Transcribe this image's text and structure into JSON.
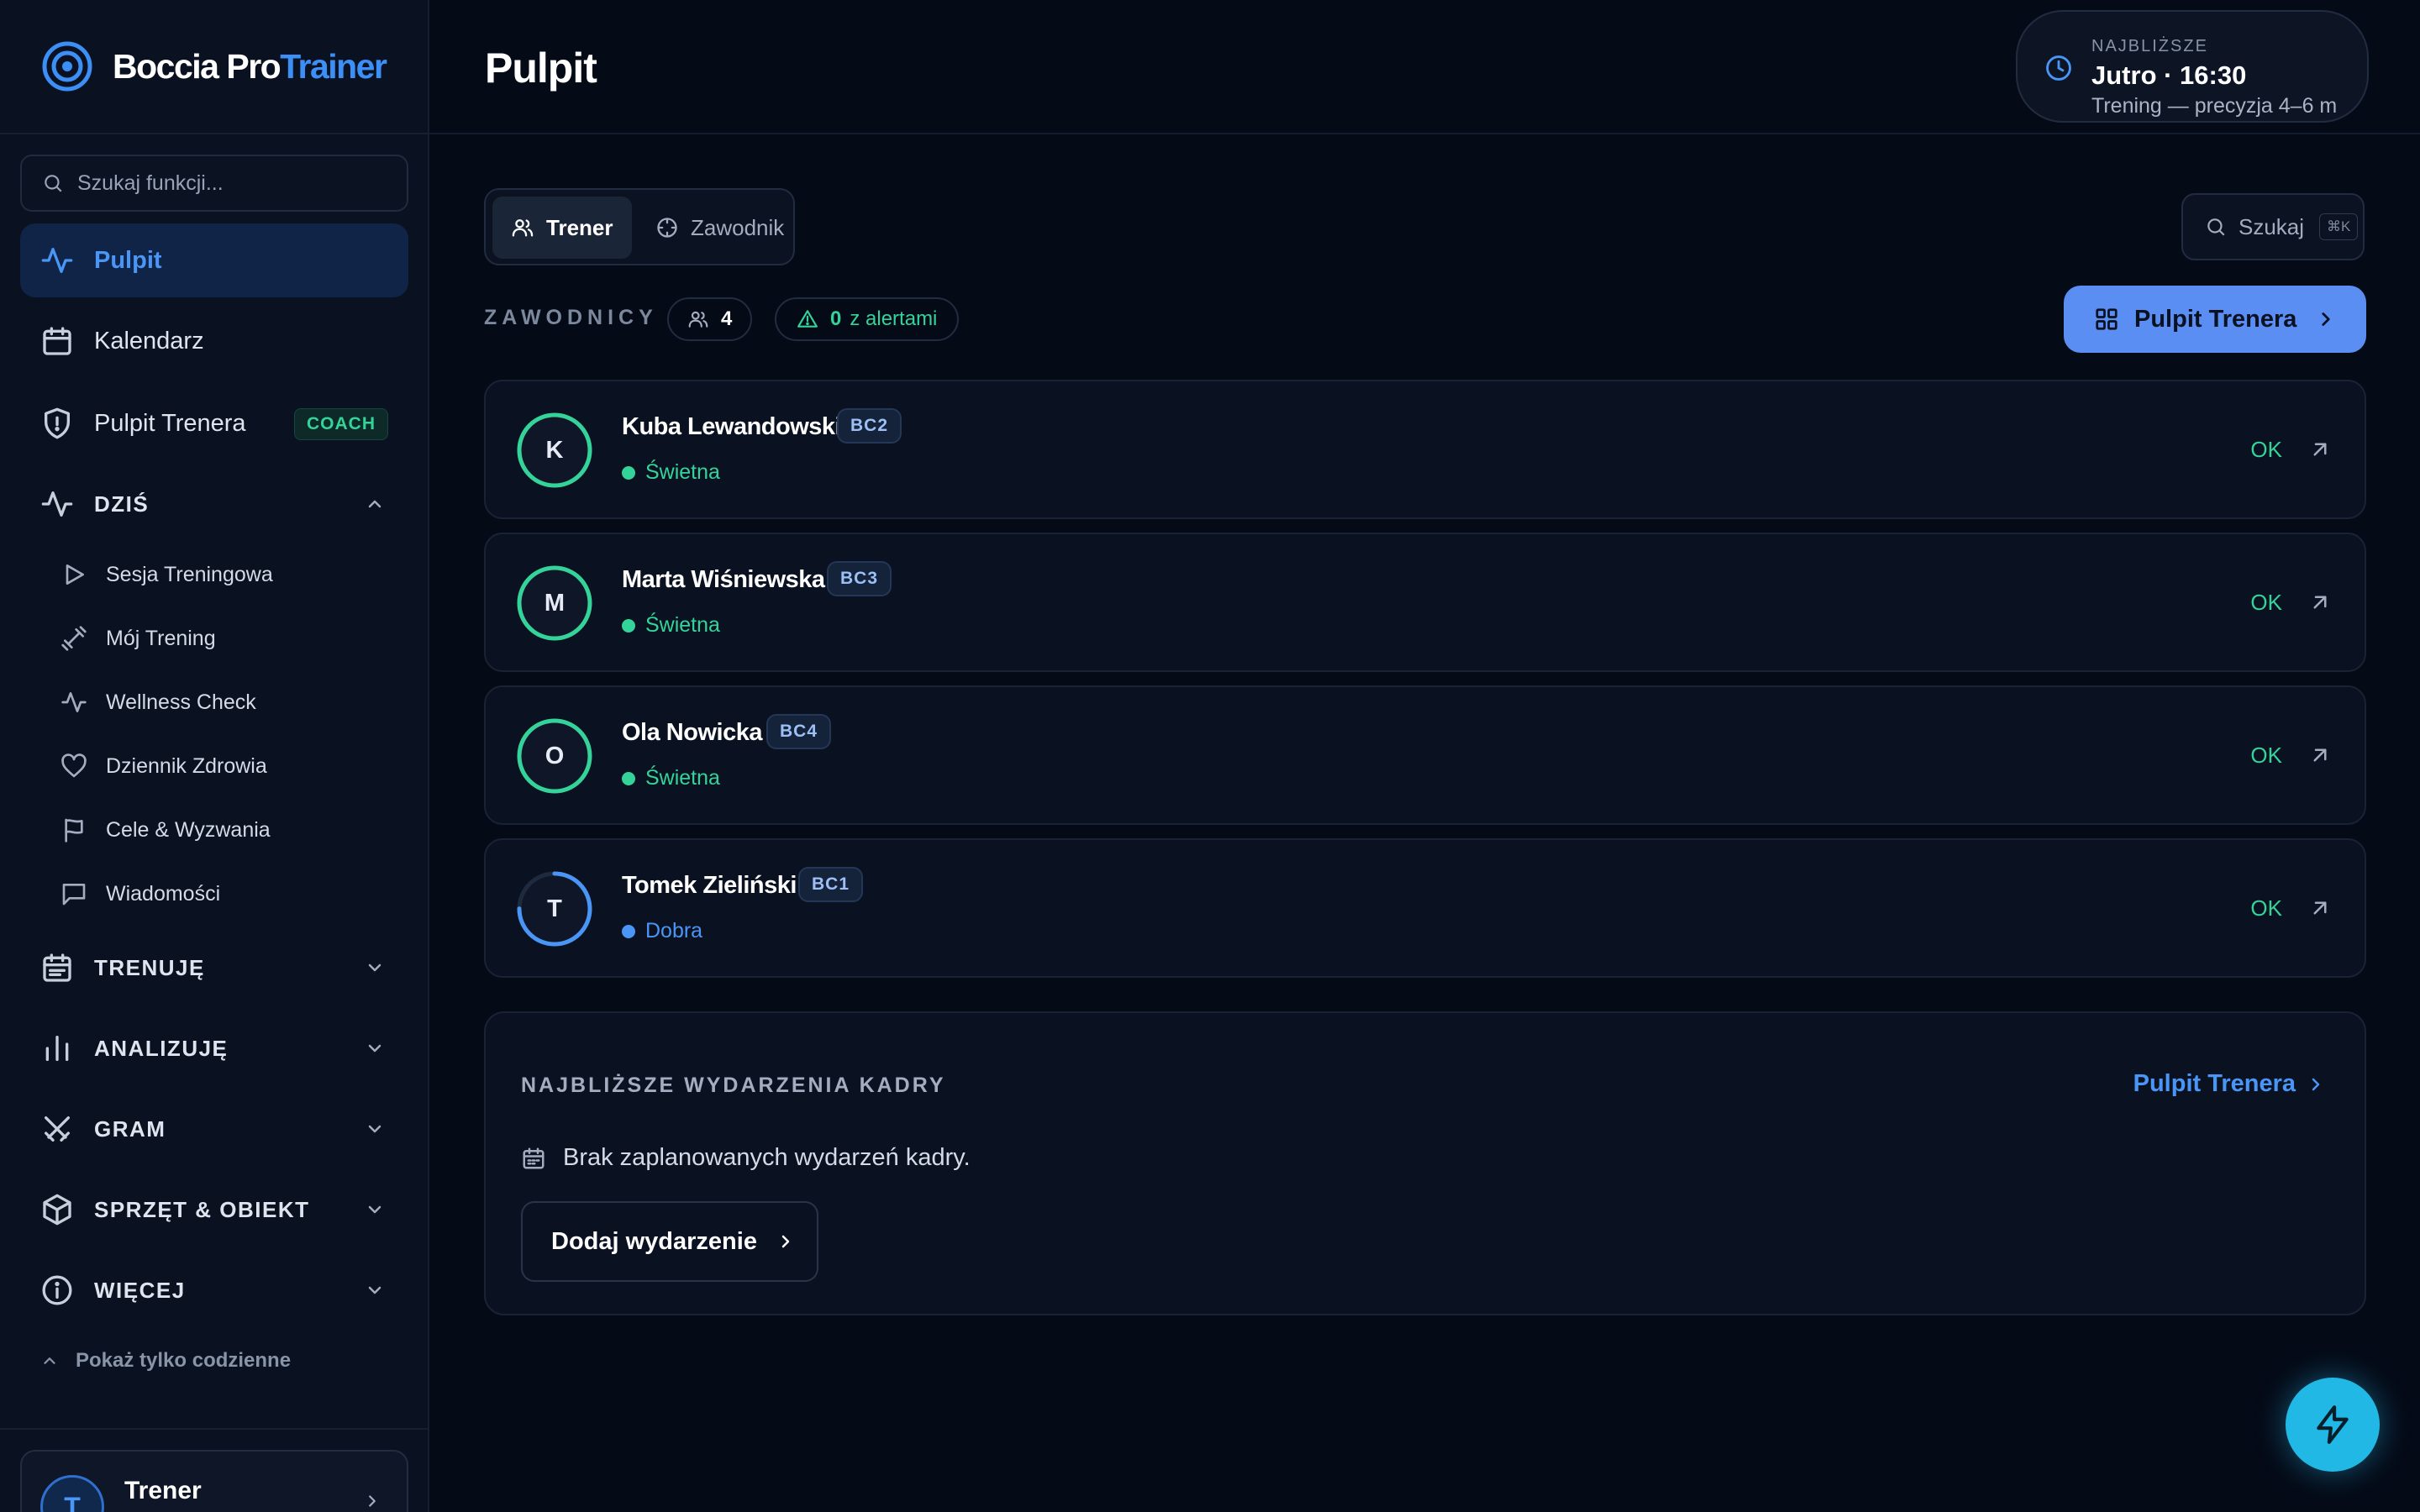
{
  "app": {
    "brand_main": "Boccia Pro",
    "brand_accent": "Trainer",
    "accent_color": "#3b8ff7"
  },
  "sidebar": {
    "search_placeholder": "Szukaj funkcji...",
    "nav": [
      {
        "label": "Pulpit",
        "icon": "activity-icon",
        "active": true
      },
      {
        "label": "Kalendarz",
        "icon": "calendar-icon"
      },
      {
        "label": "Pulpit Trenera",
        "icon": "shield-icon",
        "badge": "COACH"
      }
    ],
    "today": {
      "label": "DZIŚ",
      "items": [
        {
          "label": "Sesja Treningowa",
          "icon": "play-icon"
        },
        {
          "label": "Mój Trening",
          "icon": "dumbbell-icon"
        },
        {
          "label": "Wellness Check",
          "icon": "pulse-icon"
        },
        {
          "label": "Dziennik Zdrowia",
          "icon": "heart-icon"
        },
        {
          "label": "Cele & Wyzwania",
          "icon": "flag-icon"
        },
        {
          "label": "Wiadomości",
          "icon": "message-icon"
        }
      ]
    },
    "sections": [
      {
        "label": "TRENUJĘ",
        "icon": "calendar-list-icon"
      },
      {
        "label": "ANALIZUJĘ",
        "icon": "bar-chart-icon"
      },
      {
        "label": "GRAM",
        "icon": "swords-icon"
      },
      {
        "label": "SPRZĘT & OBIEKT",
        "icon": "box-icon"
      },
      {
        "label": "WIĘCEJ",
        "icon": "info-icon"
      }
    ],
    "show_daily": "Pokaż tylko codzienne",
    "user": {
      "initial": "T",
      "name": "Trener"
    }
  },
  "header": {
    "title": "Pulpit",
    "next": {
      "label": "NAJBLIŻSZE",
      "time": "Jutro · 16:30",
      "desc": "Trening — precyzja 4–6 m"
    }
  },
  "main": {
    "roles": [
      {
        "label": "Trener",
        "active": true
      },
      {
        "label": "Zawodnik"
      }
    ],
    "search_label": "Szukaj",
    "search_shortcut": "⌘K",
    "players_label": "ZAWODNICY",
    "players_count": "4",
    "alerts_count": "0",
    "alerts_text": "z alertami",
    "coach_dashboard_btn": "Pulpit Trenera",
    "players": [
      {
        "initial": "K",
        "name": "Kuba Lewandowski",
        "class": "BC2",
        "status": "Świetna",
        "status_color": "#34d399",
        "ok": "OK",
        "ring_fraction": 1.0
      },
      {
        "initial": "M",
        "name": "Marta Wiśniewska",
        "class": "BC3",
        "status": "Świetna",
        "status_color": "#34d399",
        "ok": "OK",
        "ring_fraction": 1.0
      },
      {
        "initial": "O",
        "name": "Ola Nowicka",
        "class": "BC4",
        "status": "Świetna",
        "status_color": "#34d399",
        "ok": "OK",
        "ring_fraction": 1.0
      },
      {
        "initial": "T",
        "name": "Tomek Zieliński",
        "class": "BC1",
        "status": "Dobra",
        "status_color": "#4a96f7",
        "ok": "OK",
        "ring_fraction": 0.75
      }
    ],
    "events": {
      "title": "NAJBLIŻSZE WYDARZENIA KADRY",
      "link": "Pulpit Trenera",
      "empty": "Brak zaplanowanych wydarzeń kadry.",
      "add_btn": "Dodaj wydarzenie"
    }
  }
}
